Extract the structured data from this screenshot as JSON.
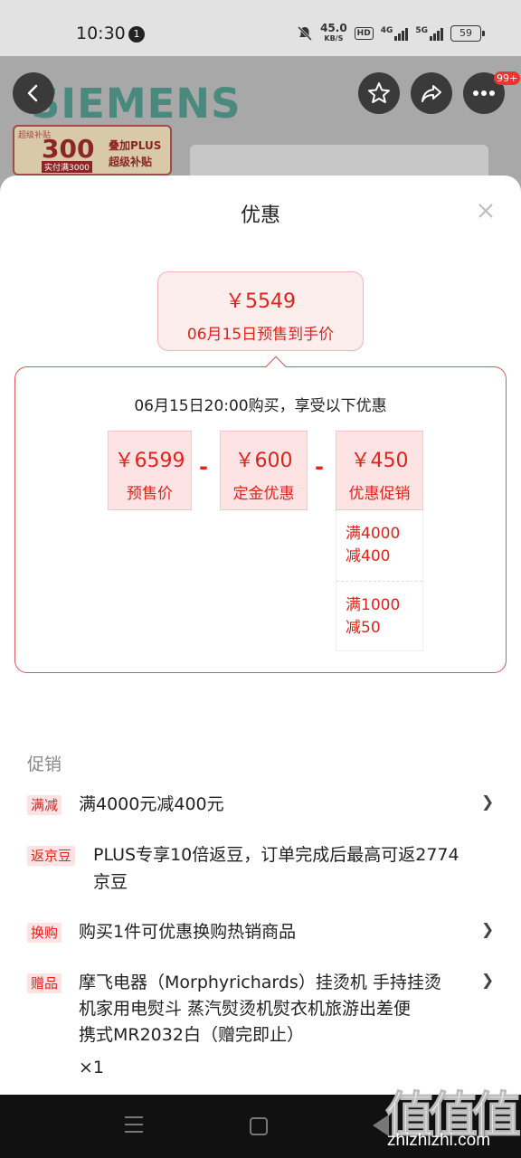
{
  "status_bar": {
    "time": "10:30",
    "notification_count": "1",
    "net_speed": "45.0",
    "net_unit": "KB/S",
    "hd": "HD",
    "sig1_label": "4G",
    "sig2_label": "5G",
    "battery": "59"
  },
  "product_header": {
    "brand": "SIEMENS",
    "badge": {
      "corner": "超级补贴",
      "amount": "300",
      "condition": "实付满3000",
      "line1": "叠加PLUS",
      "line2": "超级补贴"
    },
    "more_badge": "99+"
  },
  "sheet": {
    "title": "优惠",
    "final_price": "￥5549",
    "final_price_label": "06月15日预售到手价",
    "calc": {
      "title": "06月15日20:00购买，享受以下优惠",
      "tiles": [
        {
          "value": "￥6599",
          "label": "预售价"
        },
        {
          "value": "￥600",
          "label": "定金优惠"
        },
        {
          "value": "￥450",
          "label": "优惠促销"
        }
      ],
      "operator": "-",
      "sub_items": [
        {
          "line1": "满4000",
          "line2": "减400"
        },
        {
          "line1": "满1000",
          "line2": "减50"
        }
      ]
    },
    "promo_heading": "促销",
    "promos": [
      {
        "tag": "满减",
        "lines": [
          "满4000元减400元"
        ],
        "chevron": "❯"
      },
      {
        "tag": "返京豆",
        "lines": [
          "PLUS专享10倍返豆，订单完成后最高可返2774",
          "京豆"
        ]
      },
      {
        "tag": "换购",
        "lines": [
          "购买1件可优惠换购热销商品"
        ],
        "chevron": "❯"
      },
      {
        "tag": "赠品",
        "lines": [
          "摩飞电器（Morphyrichards）挂烫机 手持挂烫",
          "机家用电熨斗 蒸汽熨烫机熨衣机旅游出差便",
          "携式MR2032白（赠完即止）"
        ],
        "quantity": "×1",
        "chevron": "❯"
      }
    ]
  },
  "watermark": {
    "glyphs": "值值值",
    "url": "zhizhizhi.com"
  }
}
